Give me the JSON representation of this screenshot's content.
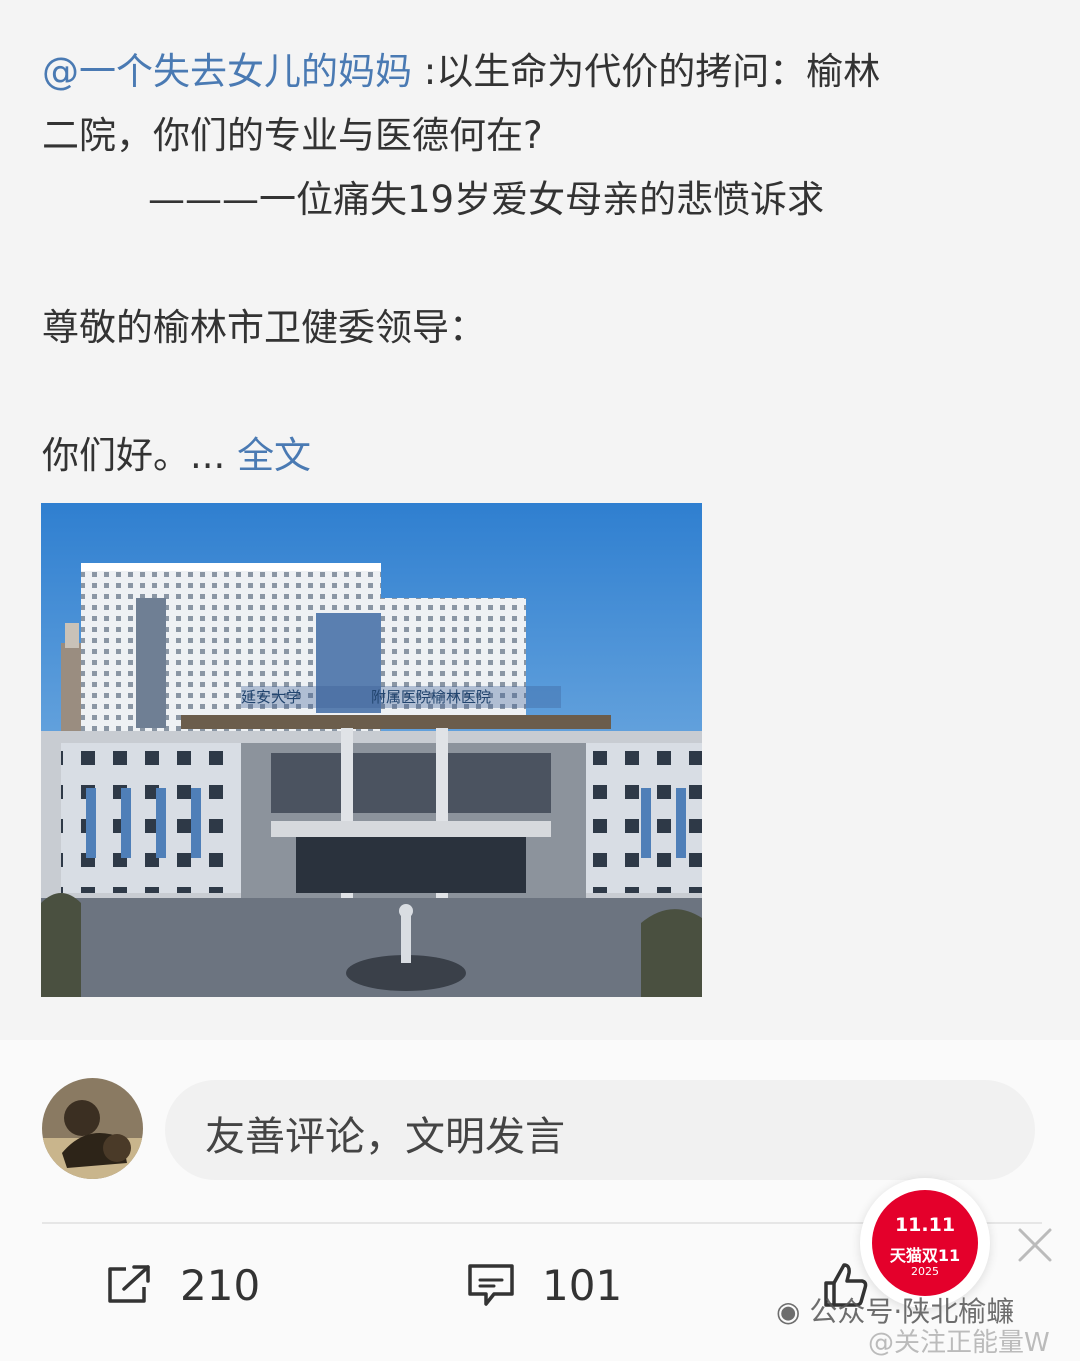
{
  "post": {
    "mention": "@一个失去女儿的妈妈",
    "title_rest": " :以生命为代价的拷问：榆林",
    "title_line2": "二院，你们的专业与医德何在?",
    "subtitle": "———一位痛失19岁爱女母亲的悲愤诉求",
    "salutation": "尊敬的榆林市卫健委领导：",
    "greeting": "你们好。...",
    "full_text_link": "全文"
  },
  "photo": {
    "signage_left": "延安大学",
    "signage_right": "附属医院榆林医院"
  },
  "comment_input": {
    "placeholder": "友善评论，文明发言"
  },
  "actions": {
    "repost_count": "210",
    "comment_count": "101"
  },
  "promo": {
    "top": "11.11",
    "name": "天猫双11",
    "year": "2025"
  },
  "watermarks": {
    "wechat": "公众号·陕北榆蠊",
    "weibo": "@关注正能量W"
  }
}
